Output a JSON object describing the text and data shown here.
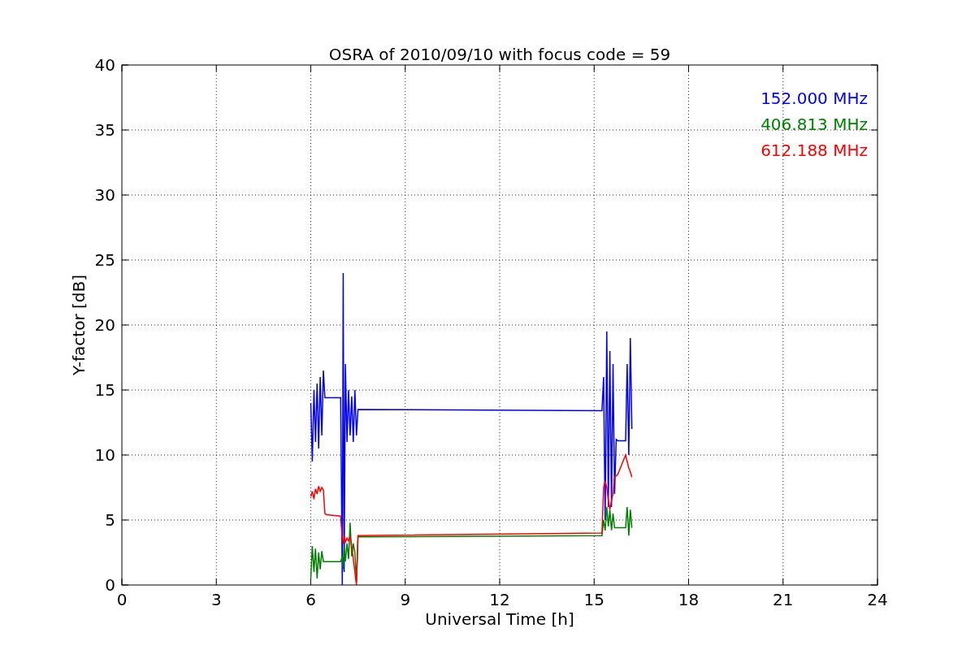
{
  "figure": {
    "chart_data": {
      "type": "line",
      "title": "OSRA of 2010/09/10 with focus code = 59",
      "xlabel": "Universal Time [h]",
      "ylabel": "Y-factor [dB]",
      "x": [
        6.0,
        6.05,
        6.1,
        6.15,
        6.2,
        6.25,
        6.3,
        6.35,
        6.4,
        6.45,
        6.5,
        6.95,
        7.0,
        7.03,
        7.06,
        7.1,
        7.15,
        7.2,
        7.25,
        7.3,
        7.35,
        7.4,
        7.45,
        7.5,
        15.25,
        15.3,
        15.35,
        15.4,
        15.45,
        15.5,
        15.55,
        15.6,
        15.65,
        15.7,
        15.75,
        16.0,
        16.05,
        16.1,
        16.15,
        16.2
      ],
      "series": [
        {
          "name": "152.000 MHz",
          "color": "#0000ff",
          "values": [
            14,
            9.5,
            15,
            11,
            15.5,
            10.5,
            16,
            11.5,
            16.5,
            14.4,
            14.4,
            14.4,
            0,
            24,
            1,
            17,
            11,
            15,
            11.5,
            14.5,
            11,
            15,
            11.5,
            13.5,
            13.4,
            16,
            5,
            19.5,
            6,
            18,
            6,
            17,
            7,
            11.2,
            11.1,
            11.1,
            17,
            10,
            19,
            12
          ]
        },
        {
          "name": "406.813 MHz",
          "color": "#008000",
          "values": [
            0.5,
            3,
            1,
            2.8,
            0.5,
            2.5,
            1.2,
            2.6,
            1.8,
            1.8,
            1.8,
            1.8,
            2.2,
            1.2,
            3,
            1.8,
            3.2,
            2.0,
            4.8,
            2.2,
            3.2,
            2.5,
            0.2,
            3.7,
            3.8,
            5,
            4.2,
            6,
            4.5,
            5.8,
            4.2,
            5.5,
            4.4,
            4.4,
            4.4,
            4.4,
            6,
            3.8,
            5.8,
            4.4
          ]
        },
        {
          "name": "612.188 MHz",
          "color": "#ff0000",
          "values": [
            6.8,
            7.2,
            6.6,
            7.4,
            7.0,
            7.6,
            7.2,
            7.5,
            7.3,
            5.5,
            5.4,
            5.3,
            3.5,
            3.2,
            3.8,
            3.3,
            3.6,
            3.4,
            3.7,
            3.0,
            2.0,
            1.0,
            0,
            3.8,
            4.0,
            7.5,
            8.0,
            7.5,
            6.5,
            5.8,
            6.5,
            7.0,
            8.3,
            8.4,
            8.5,
            10,
            9.5,
            9.0,
            8.7,
            8.3
          ]
        }
      ],
      "xlim": [
        0,
        24
      ],
      "ylim": [
        0,
        40
      ],
      "xticks": [
        0,
        3,
        6,
        9,
        12,
        15,
        18,
        21,
        24
      ],
      "yticks": [
        0,
        5,
        10,
        15,
        20,
        25,
        30,
        35,
        40
      ],
      "grid": true
    }
  }
}
